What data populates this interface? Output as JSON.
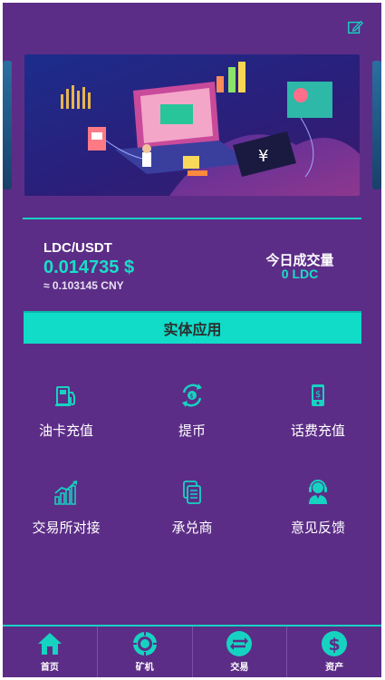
{
  "header": {
    "edit_icon": "edit-icon"
  },
  "banner": {
    "illustration": "finance-isometric-illustration"
  },
  "market": {
    "pair": "LDC/USDT",
    "price": "0.014735 $",
    "cny": "≈ 0.103145 CNY",
    "volume_label": "今日成交量",
    "volume_value": "0 LDC"
  },
  "main_button": "实体应用",
  "features": [
    {
      "label": "油卡充值",
      "icon": "fuel-pump-icon"
    },
    {
      "label": "提币",
      "icon": "coin-transfer-icon"
    },
    {
      "label": "话费充值",
      "icon": "phone-recharge-icon"
    },
    {
      "label": "交易所对接",
      "icon": "exchange-chart-icon"
    },
    {
      "label": "承兑商",
      "icon": "documents-icon"
    },
    {
      "label": "意见反馈",
      "icon": "support-agent-icon"
    }
  ],
  "tabs": [
    {
      "label": "首页",
      "icon": "home-icon"
    },
    {
      "label": "矿机",
      "icon": "mining-machine-icon"
    },
    {
      "label": "交易",
      "icon": "exchange-icon"
    },
    {
      "label": "资产",
      "icon": "dollar-icon"
    }
  ],
  "colors": {
    "background": "#5c2d87",
    "accent": "#16d3c1",
    "button": "#10dcc8"
  }
}
